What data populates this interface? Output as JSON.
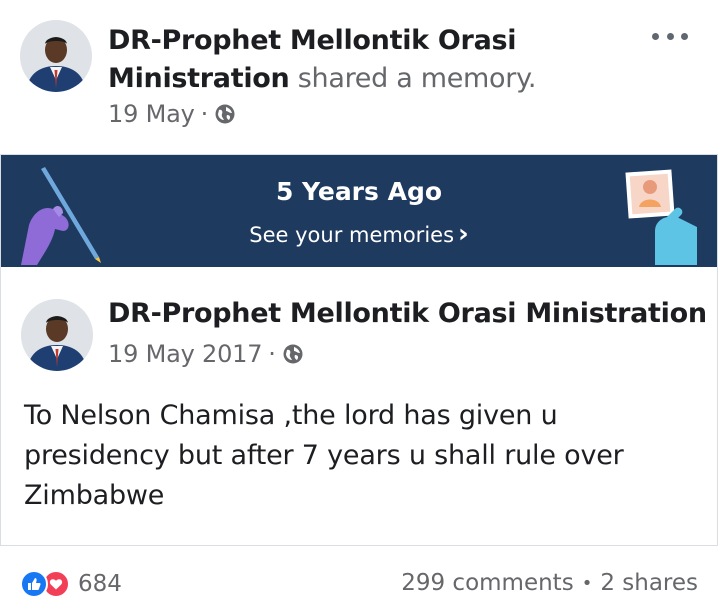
{
  "post": {
    "author": "DR-Prophet Mellontik Orasi Ministration",
    "action": "shared a memory.",
    "date": "19 May",
    "dot": "·",
    "privacy_icon": "globe-icon",
    "menu_icon": "more-options-icon"
  },
  "memory_banner": {
    "title": "5 Years Ago",
    "link": "See your memories",
    "chevron": "›",
    "background": "#1f3a5f"
  },
  "original_post": {
    "author": "DR-Prophet Mellontik Orasi Ministration",
    "date": "19 May 2017",
    "dot": "·",
    "text": "To Nelson Chamisa ,the lord has given u presidency but after 7 years u shall rule over Zimbabwe"
  },
  "engagement": {
    "reaction_count": "684",
    "comments": "299 comments",
    "separator": "•",
    "shares": "2 shares",
    "like_color": "#1877f2",
    "love_color": "#f33e58"
  }
}
